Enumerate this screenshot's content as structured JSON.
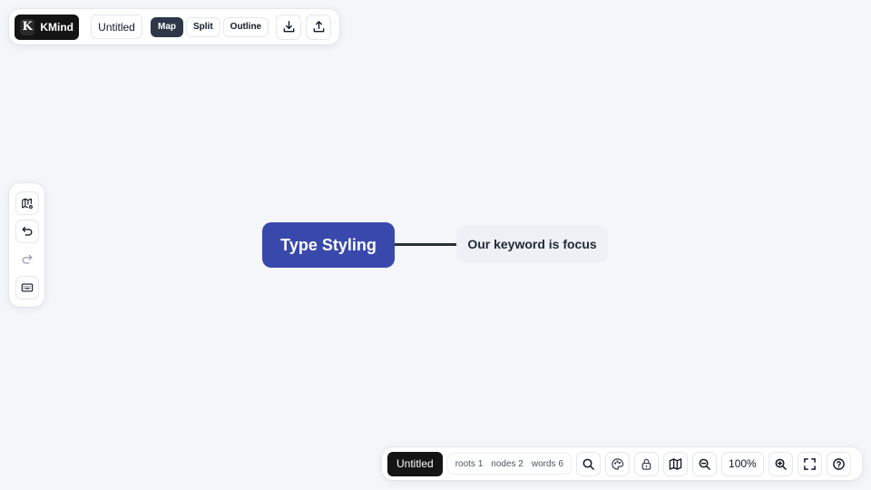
{
  "app": {
    "logo_letter": "K",
    "name": "KMind"
  },
  "document": {
    "title": "Untitled"
  },
  "view_modes": [
    {
      "label": "Map",
      "active": true
    },
    {
      "label": "Split",
      "active": false
    },
    {
      "label": "Outline",
      "active": false
    }
  ],
  "top_actions": [
    {
      "icon": "download-icon"
    },
    {
      "icon": "upload-icon"
    }
  ],
  "left_tools": [
    {
      "icon": "map-settings-icon"
    },
    {
      "icon": "undo-icon"
    },
    {
      "icon": "redo-icon"
    },
    {
      "icon": "keyboard-icon"
    }
  ],
  "mindmap": {
    "root": {
      "text": "Type Styling",
      "color": "#3949ab"
    },
    "children": [
      {
        "text": "Our keyword is focus"
      }
    ]
  },
  "status": {
    "file": "Untitled",
    "roots": "roots 1",
    "nodes": "nodes 2",
    "words": "words 6",
    "zoom": "100%"
  },
  "bottom_tools": [
    "search-icon",
    "theme-icon",
    "lock-icon",
    "minimap-icon",
    "zoom-out-icon",
    "zoom-in-icon",
    "fullscreen-icon",
    "help-icon"
  ]
}
